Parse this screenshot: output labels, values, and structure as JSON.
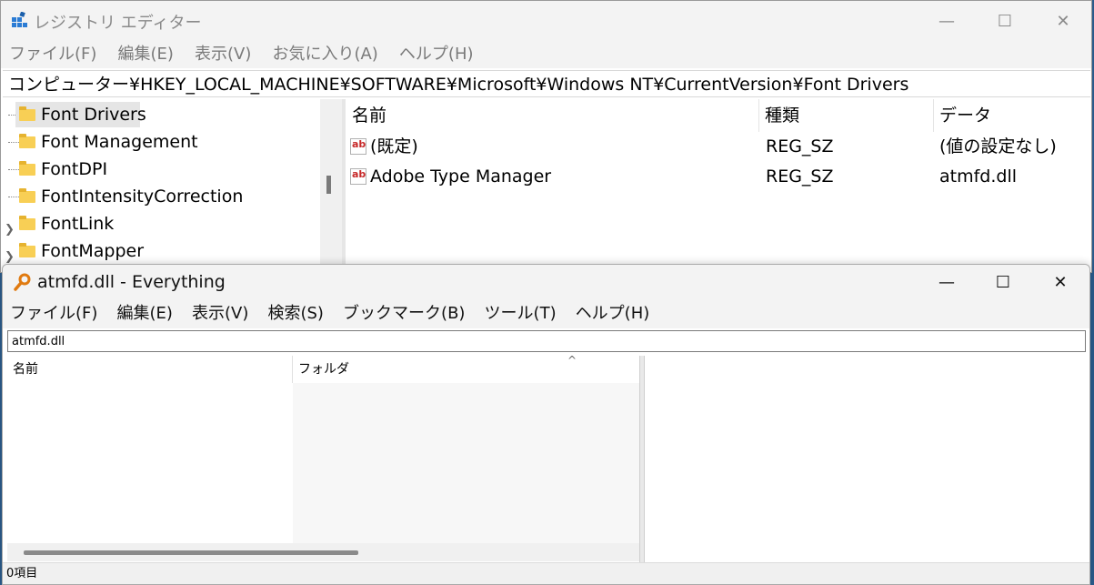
{
  "regedit": {
    "title": "レジストリ エディター",
    "menu": [
      "ファイル(F)",
      "編集(E)",
      "表示(V)",
      "お気に入り(A)",
      "ヘルプ(H)"
    ],
    "address": "コンピューター¥HKEY_LOCAL_MACHINE¥SOFTWARE¥Microsoft¥Windows NT¥CurrentVersion¥Font Drivers",
    "tree": [
      {
        "label": "Font Drivers",
        "selected": true,
        "expandable": false
      },
      {
        "label": "Font Management",
        "selected": false,
        "expandable": false
      },
      {
        "label": "FontDPI",
        "selected": false,
        "expandable": false
      },
      {
        "label": "FontIntensityCorrection",
        "selected": false,
        "expandable": false
      },
      {
        "label": "FontLink",
        "selected": false,
        "expandable": true
      },
      {
        "label": "FontMapper",
        "selected": false,
        "expandable": true
      }
    ],
    "columns": {
      "name": "名前",
      "type": "種類",
      "data": "データ"
    },
    "values": [
      {
        "name": "(既定)",
        "type": "REG_SZ",
        "data": "(値の設定なし)"
      },
      {
        "name": "Adobe Type Manager",
        "type": "REG_SZ",
        "data": "atmfd.dll"
      }
    ],
    "value_icon_text": "ab"
  },
  "everything": {
    "title": "atmfd.dll - Everything",
    "menu": [
      "ファイル(F)",
      "編集(E)",
      "表示(V)",
      "検索(S)",
      "ブックマーク(B)",
      "ツール(T)",
      "ヘルプ(H)"
    ],
    "search_value": "atmfd.dll",
    "columns": {
      "name": "名前",
      "folder": "フォルダ"
    },
    "sort_indicator": "^",
    "status": "0項目"
  },
  "caption_glyphs": {
    "minimize": "—",
    "maximize": "☐",
    "close": "✕"
  },
  "colors": {
    "folder": "#f8cf55",
    "selection": "#e5e5e5",
    "icon_red": "#c62828",
    "everything_icon": "#e07a10"
  }
}
